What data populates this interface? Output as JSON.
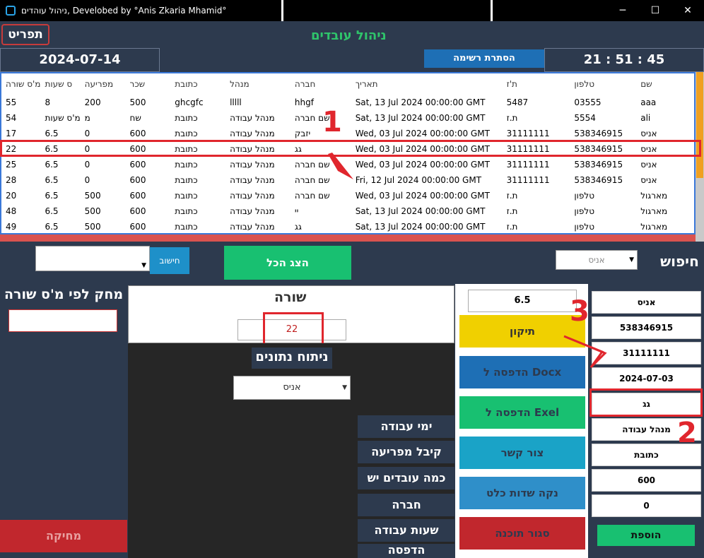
{
  "window": {
    "title": "ניהול עוהדים, Develobed by °Anis Zkaria Mhamid°",
    "minimize": "─",
    "maximize": "☐",
    "close": "✕"
  },
  "header": {
    "print_label": "תפריט",
    "app_title": "ניהול עובדים",
    "date": "2024-07-14",
    "hide_list_label": "הסתרת רשימה",
    "time": "21 : 51 : 45"
  },
  "table": {
    "columns": [
      "מ'ס שורה",
      "ס שעות",
      "מפריעה",
      "שכר",
      "כתובת",
      "מנהל",
      "חברה",
      "תאריך",
      "ת'ז",
      "טלפון",
      "שם"
    ],
    "rows": [
      [
        "55",
        "8",
        "200",
        "500",
        "ghcgfc",
        "lllll",
        "hhgf",
        "Sat, 13 Jul 2024 00:00:00 GMT",
        "5487",
        "03555",
        "aaa"
      ],
      [
        "54",
        "מ'ס שעות",
        "מ",
        "שח",
        "כתובת",
        "מנהל עבודה",
        "שם חברה",
        "Sat, 13 Jul 2024 00:00:00 GMT",
        "ת.ז",
        "5554",
        "ali"
      ],
      [
        "17",
        "6.5",
        "0",
        "600",
        "כתובת",
        "מנהל עבודה",
        "יזבק",
        "Wed, 03 Jul 2024 00:00:00 GMT",
        "31111111",
        "538346915",
        "אניס"
      ],
      [
        "22",
        "6.5",
        "0",
        "600",
        "כתובת",
        "מנהל עבודה",
        "גג",
        "Wed, 03 Jul 2024 00:00:00 GMT",
        "31111111",
        "538346915",
        "אניס"
      ],
      [
        "25",
        "6.5",
        "0",
        "600",
        "כתובת",
        "מנהל עבודה",
        "שם חברה",
        "Wed, 03 Jul 2024 00:00:00 GMT",
        "31111111",
        "538346915",
        "אניס"
      ],
      [
        "28",
        "6.5",
        "0",
        "600",
        "כתובת",
        "מנהל עבודה",
        "שם חברה",
        "Fri, 12 Jul 2024 00:00:00 GMT",
        "31111111",
        "538346915",
        "אניס"
      ],
      [
        "20",
        "6.5",
        "500",
        "600",
        "כתובת",
        "מנהל עבודה",
        "שם חברה",
        "Wed, 03 Jul 2024 00:00:00 GMT",
        "ת.ז",
        "טלפון",
        "מארגול"
      ],
      [
        "48",
        "6.5",
        "500",
        "600",
        "כתובת",
        "מנהל עבודה",
        "יי",
        "Sat, 13 Jul 2024 00:00:00 GMT",
        "ת.ז",
        "טלפון",
        "מארגול"
      ],
      [
        "49",
        "6.5",
        "500",
        "600",
        "כתובת",
        "מנהל עבודה",
        "גג",
        "Sat, 13 Jul 2024 00:00:00 GMT",
        "ת.ז",
        "טלפון",
        "מארגול"
      ]
    ]
  },
  "annotations": {
    "n1": "1",
    "n2": "2",
    "n3": "3"
  },
  "controls": {
    "calc_label": "חישוב",
    "show_all_label": "הצג הכל",
    "search_value": "אניס",
    "search_label": "חיפוש"
  },
  "left": {
    "delete_by_row_label": "מחק לפי מ'ס שורה",
    "delete_button": "מחיקה"
  },
  "center": {
    "row_label": "שורה",
    "row_value": "22",
    "analysis_title": "ניתוח נתונים",
    "analysis_value": "אניס",
    "analysis_buttons": [
      "ימי עבודה",
      "קיבל מפריעה",
      "כמה עובדים יש",
      "חברה",
      "שעות עבודה",
      "הדפסה"
    ]
  },
  "actions": {
    "hours_value": "6.5",
    "edit": "תיקון",
    "print_docx": "הדפסה ל Docx",
    "print_excel": "הדפסה ל Exel",
    "contact": "צור קשר",
    "clear": "נקה שדות כלט",
    "close": "סגור תוכנה"
  },
  "fields": [
    "אניס",
    "538346915",
    "31111111",
    "2024-07-03",
    "גג",
    "מנהל עבודה",
    "כתובת",
    "600",
    "0"
  ],
  "add_label": "הוספת",
  "colors": {
    "accent_red": "#e0262d",
    "green": "#18c071",
    "dark_bg": "#2d3a4e"
  }
}
